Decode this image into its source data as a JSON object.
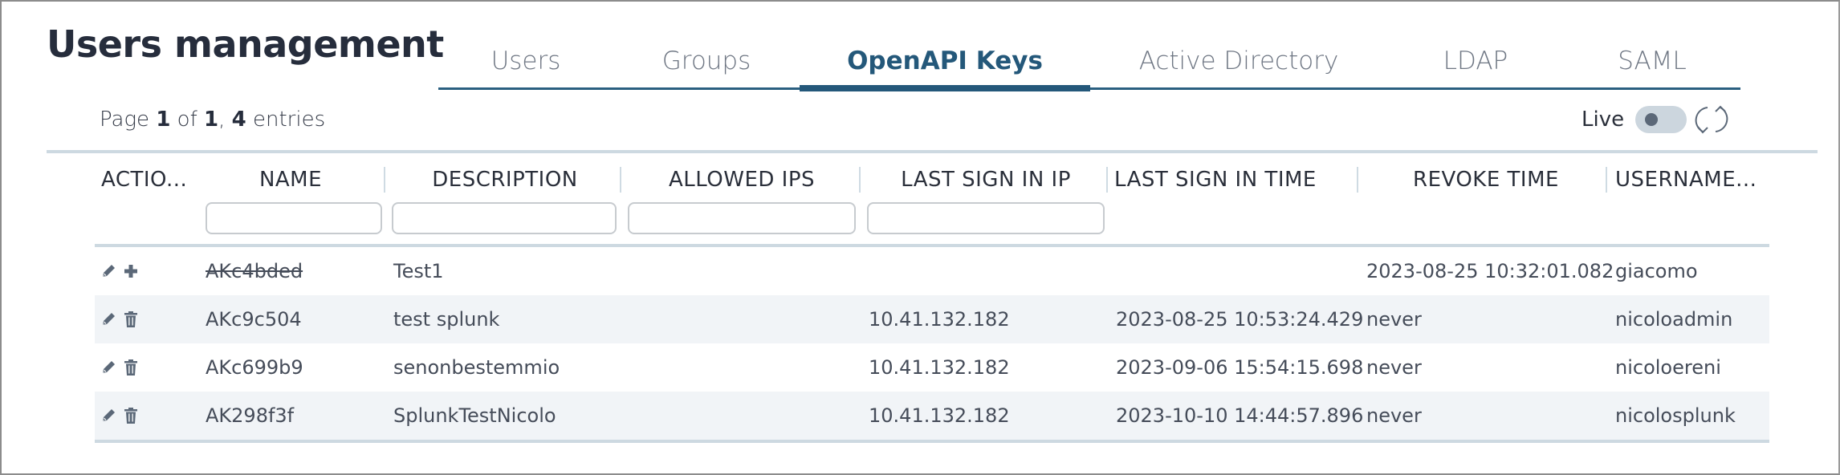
{
  "header": {
    "title": "Users management"
  },
  "tabs": [
    {
      "label": "Users",
      "active": false
    },
    {
      "label": "Groups",
      "active": false
    },
    {
      "label": "OpenAPI Keys",
      "active": true
    },
    {
      "label": "Active Directory",
      "active": false
    },
    {
      "label": "LDAP",
      "active": false
    },
    {
      "label": "SAML",
      "active": false
    }
  ],
  "pagination": {
    "prefix": "Page",
    "current": "1",
    "of": "of",
    "total": "1",
    "count": "4",
    "suffix": "entries"
  },
  "live": {
    "label": "Live",
    "enabled": false
  },
  "table": {
    "columns": [
      {
        "label": "ACTIO...",
        "filterable": false
      },
      {
        "label": "NAME",
        "filterable": true,
        "filter_value": ""
      },
      {
        "label": "DESCRIPTION",
        "filterable": true,
        "filter_value": ""
      },
      {
        "label": "ALLOWED IPS",
        "filterable": true,
        "filter_value": ""
      },
      {
        "label": "LAST SIGN IN IP",
        "filterable": true,
        "filter_value": ""
      },
      {
        "label": "LAST SIGN IN TIME",
        "filterable": false
      },
      {
        "label": "REVOKE TIME",
        "filterable": false
      },
      {
        "label": "USERNAME...",
        "filterable": false
      }
    ],
    "rows": [
      {
        "actions": [
          "edit-icon",
          "plus-icon"
        ],
        "name": "AKc4bded",
        "revoked": true,
        "description": "Test1",
        "allowed_ips": "",
        "last_sign_in_ip": "",
        "last_sign_in_time": "",
        "revoke_time": "2023-08-25 10:32:01.082",
        "username": "giacomo"
      },
      {
        "actions": [
          "edit-icon",
          "trash-icon"
        ],
        "name": "AKc9c504",
        "revoked": false,
        "description": "test splunk",
        "allowed_ips": "",
        "last_sign_in_ip": "10.41.132.182",
        "last_sign_in_time": "2023-08-25 10:53:24.429",
        "revoke_time": "never",
        "username": "nicoloadmin"
      },
      {
        "actions": [
          "edit-icon",
          "trash-icon"
        ],
        "name": "AKc699b9",
        "revoked": false,
        "description": "senonbestemmio",
        "allowed_ips": "",
        "last_sign_in_ip": "10.41.132.182",
        "last_sign_in_time": "2023-09-06 15:54:15.698",
        "revoke_time": "never",
        "username": "nicoloereni"
      },
      {
        "actions": [
          "edit-icon",
          "trash-icon"
        ],
        "name": "AK298f3f",
        "revoked": false,
        "description": "SplunkTestNicolo",
        "allowed_ips": "",
        "last_sign_in_ip": "10.41.132.182",
        "last_sign_in_time": "2023-10-10 14:44:57.896",
        "revoke_time": "never",
        "username": "nicolosplunk"
      }
    ]
  },
  "colors": {
    "accent": "#24587a",
    "rule": "#cdd9e1",
    "row_alt": "#f1f4f7",
    "text": "#454c59"
  }
}
